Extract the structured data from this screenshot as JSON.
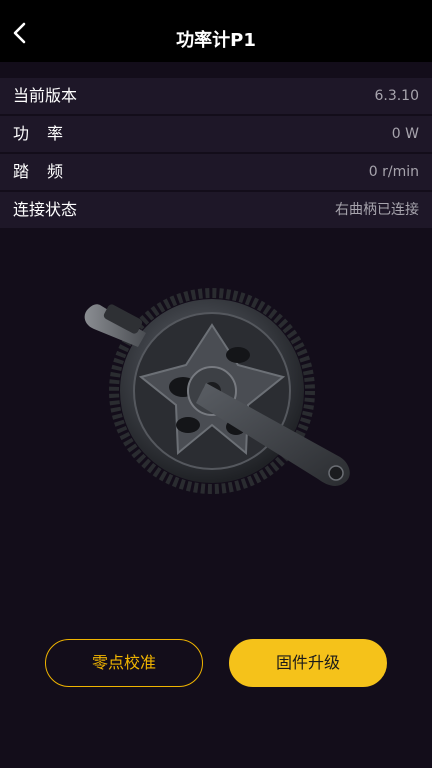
{
  "header": {
    "title": "功率计P1",
    "back_icon": "chevron-left-icon"
  },
  "info": {
    "rows": [
      {
        "label": "当前版本",
        "value": "6.3.10"
      },
      {
        "label": "功率",
        "value": "0 W"
      },
      {
        "label": "踏频",
        "value": "0 r/min"
      },
      {
        "label": "连接状态",
        "value": "右曲柄已连接"
      }
    ]
  },
  "actions": {
    "zero_calibration_label": "零点校准",
    "firmware_upgrade_label": "固件升级"
  },
  "colors": {
    "background": "#130d1a",
    "row_background": "#1e1728",
    "accent": "#f5c21a"
  }
}
